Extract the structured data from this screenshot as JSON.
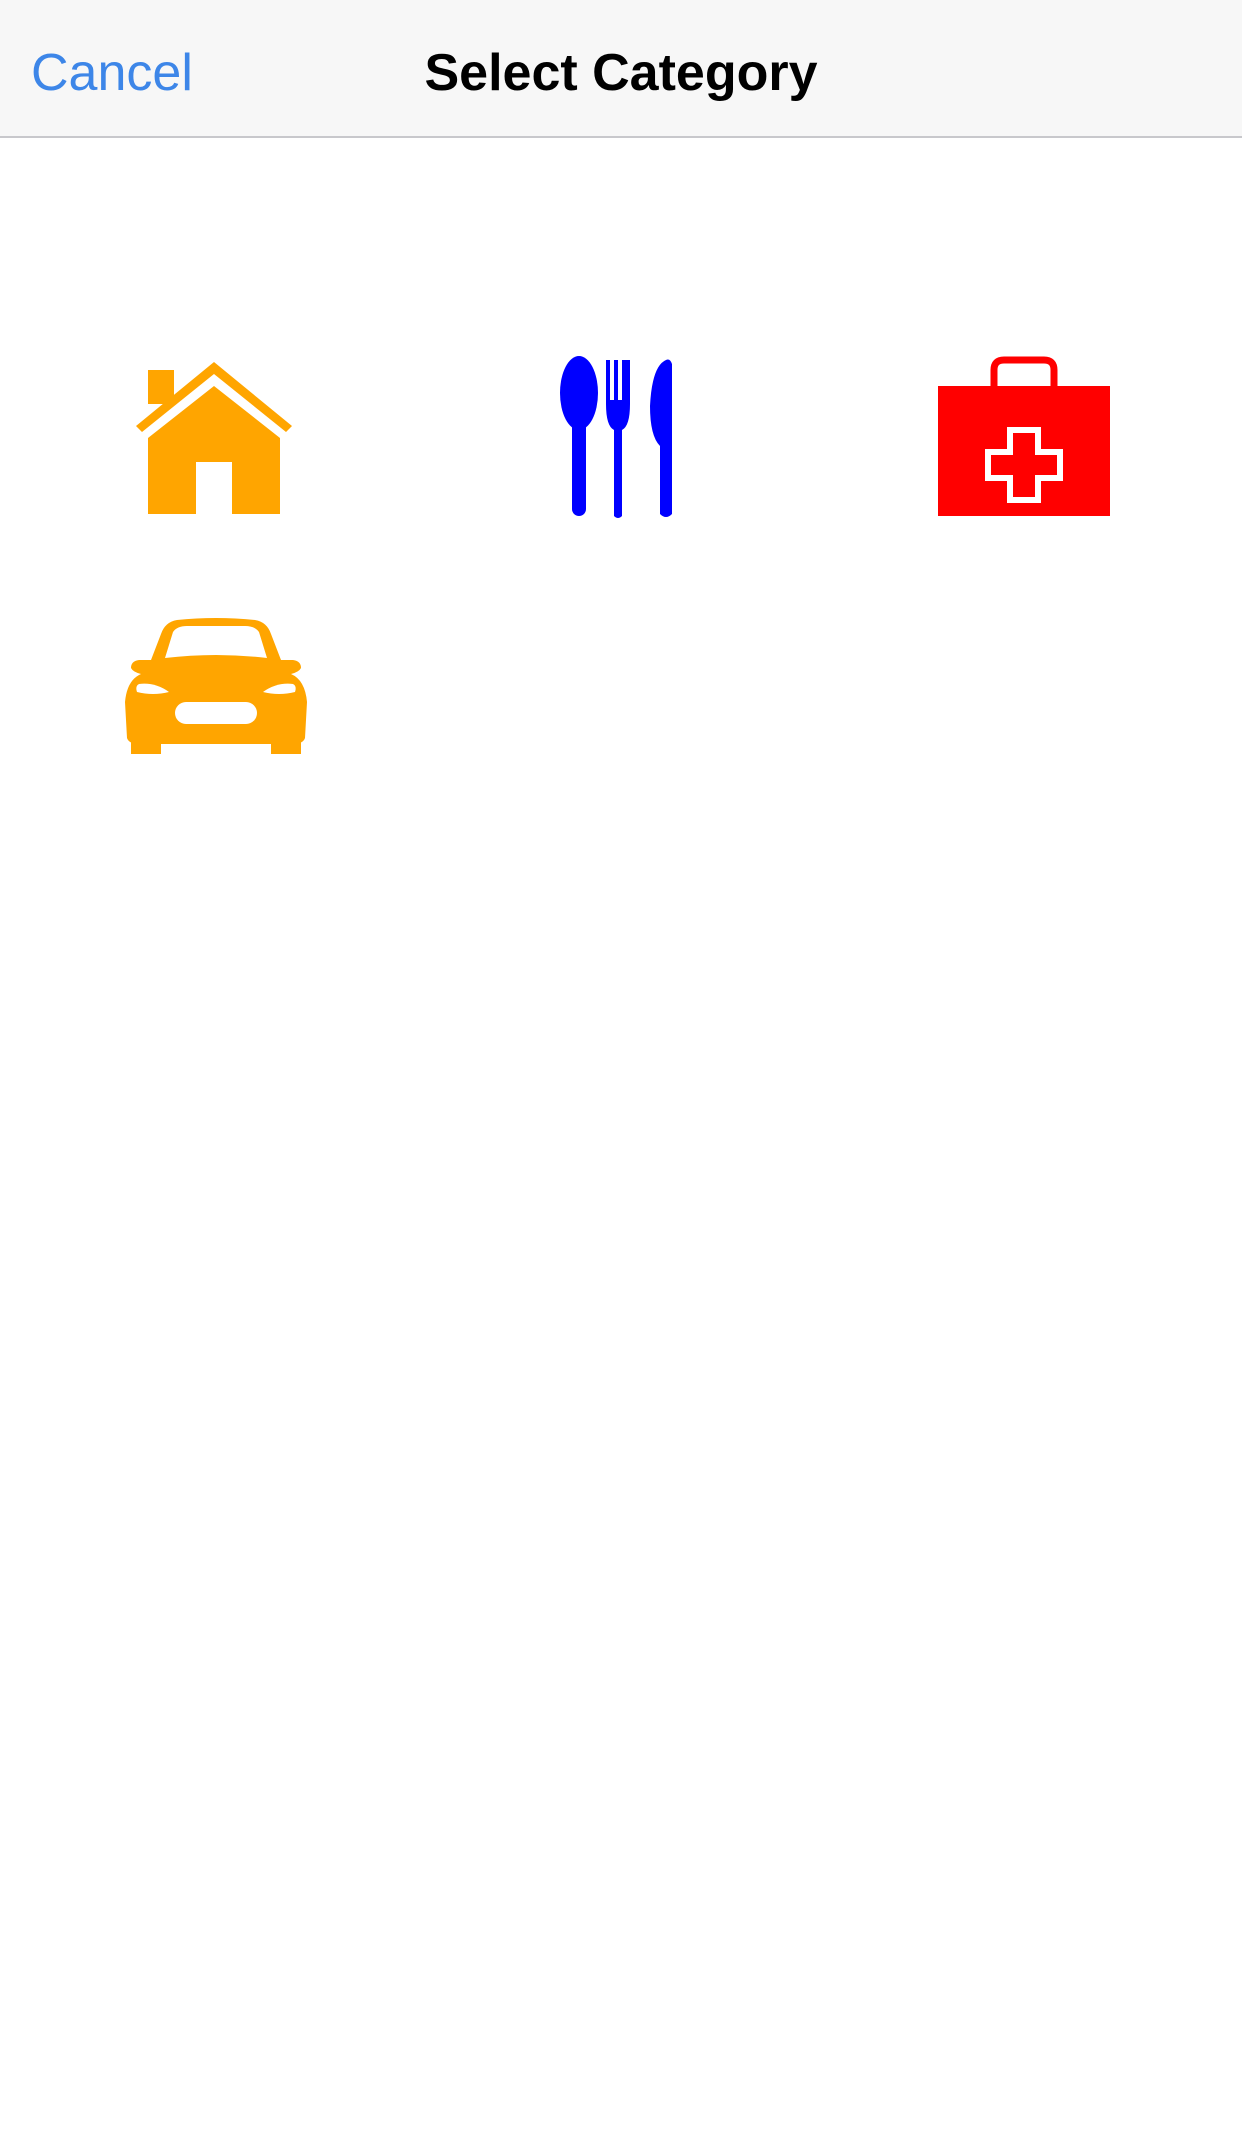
{
  "navbar": {
    "cancel_label": "Cancel",
    "title": "Select Category"
  },
  "categories": [
    {
      "icon": "house-icon",
      "color": "#ffa500"
    },
    {
      "icon": "utensils-icon",
      "color": "#0000ff"
    },
    {
      "icon": "first-aid-kit-icon",
      "color": "#ff0000"
    },
    {
      "icon": "car-icon",
      "color": "#ffa500"
    }
  ],
  "colors": {
    "accent": "#3d86e8",
    "navbar_bg": "#f7f7f7"
  }
}
